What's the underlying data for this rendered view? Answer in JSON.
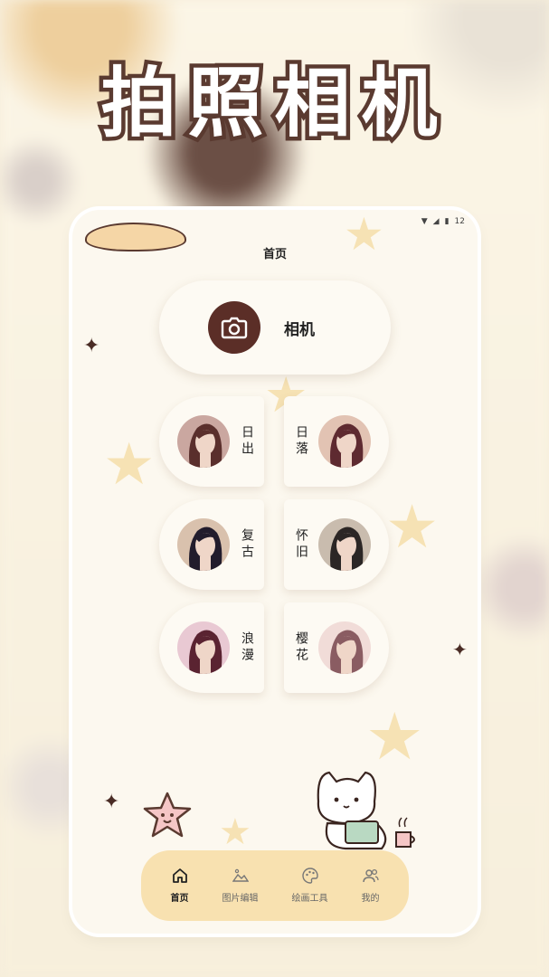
{
  "promo": {
    "title": "拍照相机"
  },
  "app": {
    "page_title": "首页",
    "status": {
      "time": "12"
    },
    "camera_button": {
      "label": "相机"
    },
    "filters": [
      {
        "label": "日出",
        "side": "left",
        "tone": [
          "#caa7a0",
          "#5a2f2c"
        ]
      },
      {
        "label": "日落",
        "side": "right",
        "tone": [
          "#e2c3b3",
          "#5e2a30"
        ]
      },
      {
        "label": "复古",
        "side": "left",
        "tone": [
          "#d9c1ad",
          "#221c2c"
        ]
      },
      {
        "label": "怀旧",
        "side": "right",
        "tone": [
          "#c9bcae",
          "#2b2625"
        ]
      },
      {
        "label": "浪漫",
        "side": "left",
        "tone": [
          "#e9c9d3",
          "#5a2331"
        ]
      },
      {
        "label": "樱花",
        "side": "right",
        "tone": [
          "#f1dcd8",
          "#8a5c62"
        ]
      }
    ],
    "tabs": [
      {
        "label": "首页",
        "icon": "home-icon",
        "active": true
      },
      {
        "label": "图片编辑",
        "icon": "image-edit-icon",
        "active": false
      },
      {
        "label": "绘画工具",
        "icon": "palette-icon",
        "active": false
      },
      {
        "label": "我的",
        "icon": "profile-icon",
        "active": false
      }
    ]
  },
  "colors": {
    "background": "#f6eedb",
    "accent_dark": "#5b2e27",
    "tab_bar": "#f8e1b0",
    "card": "#fdfaf3"
  }
}
